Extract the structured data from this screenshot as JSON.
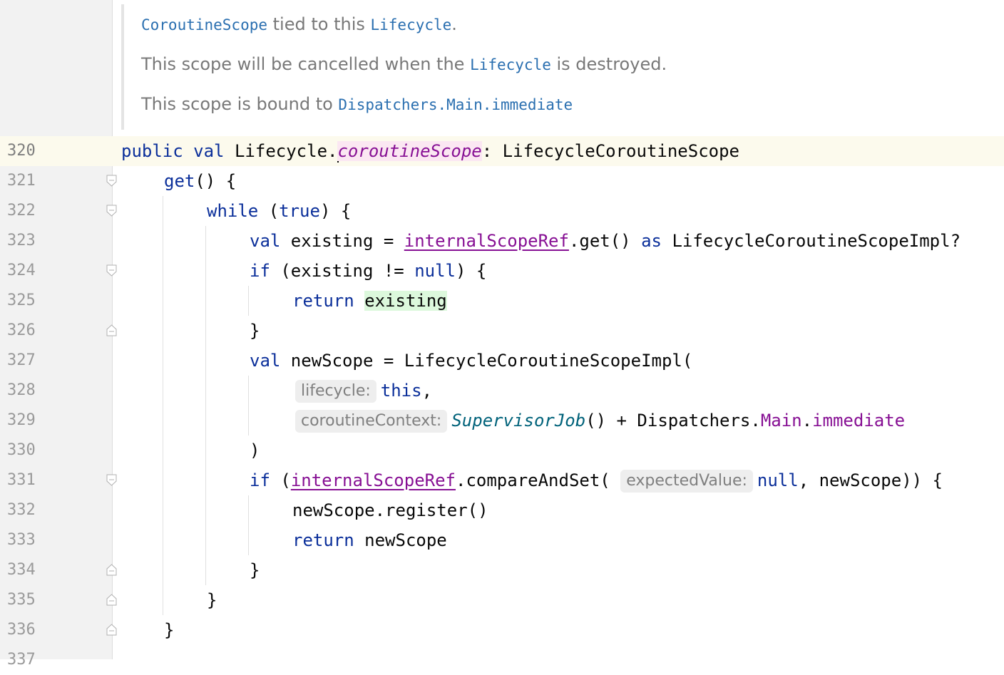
{
  "documentation": {
    "line1": {
      "code1": "CoroutineScope",
      "text1": " tied to this ",
      "code2": "Lifecycle",
      "text2": "."
    },
    "line2": {
      "text1": "This scope will be cancelled when the ",
      "code1": "Lifecycle",
      "text2": " is destroyed."
    },
    "line3": {
      "text1": "This scope is bound to ",
      "code1": "Dispatchers.Main.immediate"
    }
  },
  "line_numbers": [
    "320",
    "321",
    "322",
    "323",
    "324",
    "325",
    "326",
    "327",
    "328",
    "329",
    "330",
    "331",
    "332",
    "333",
    "334",
    "335",
    "336",
    "337"
  ],
  "code": {
    "l320": {
      "kw1": "public",
      "kw2": "val",
      "recv": "Lifecycle.",
      "prop": "coroutineScope",
      "rest": ": LifecycleCoroutineScope"
    },
    "l321": {
      "fn": "get",
      "rest": "() {"
    },
    "l322": {
      "kw": "while",
      "p1": " (",
      "kw2": "true",
      "p2": ") {"
    },
    "l323": {
      "kw": "val",
      "t1": " existing = ",
      "prop": "internalScopeRef",
      "t2": ".get() ",
      "kw2": "as",
      "t3": " LifecycleCoroutineScopeImpl?"
    },
    "l324": {
      "kw": "if",
      "t1": " (existing != ",
      "kw2": "null",
      "t2": ") {"
    },
    "l325": {
      "kw": "return",
      "t1": " ",
      "hl": "existing"
    },
    "l326": {
      "t1": "}"
    },
    "l327": {
      "kw": "val",
      "t1": " newScope = LifecycleCoroutineScopeImpl("
    },
    "l328": {
      "hint": "lifecycle:",
      "kw": "this",
      "t1": ","
    },
    "l329": {
      "hint": "coroutineContext:",
      "fn": "SupervisorJob",
      "t1": "() + Dispatchers.",
      "p1": "Main",
      "t2": ".",
      "p2": "immediate"
    },
    "l330": {
      "t1": ")"
    },
    "l331": {
      "kw": "if",
      "t1": " (",
      "prop": "internalScopeRef",
      "t2": ".compareAndSet( ",
      "hint": "expectedValue:",
      "kw2": "null",
      "t3": ", newScope)) {"
    },
    "l332": {
      "t1": "newScope.register()"
    },
    "l333": {
      "kw": "return",
      "t1": " newScope"
    },
    "l334": {
      "t1": "}"
    },
    "l335": {
      "t1": "}"
    },
    "l336": {
      "t1": "}"
    }
  }
}
